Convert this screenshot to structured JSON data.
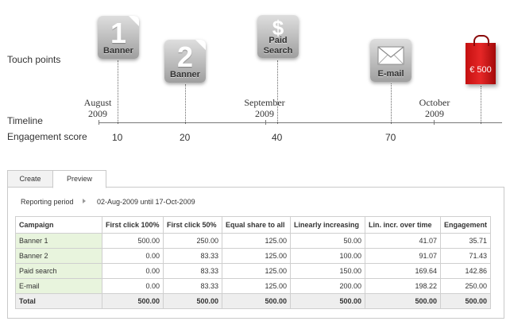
{
  "labels": {
    "touch_points": "Touch points",
    "timeline": "Timeline",
    "engagement_score": "Engagement score"
  },
  "touchpoints": [
    {
      "number": "1",
      "caption": "Banner",
      "icon": "document-1-icon"
    },
    {
      "number": "2",
      "caption": "Banner",
      "icon": "document-2-icon"
    },
    {
      "symbol": "$",
      "caption_line1": "Paid",
      "caption_line2": "Search",
      "icon": "paid-search-icon"
    },
    {
      "caption": "E-mail",
      "icon": "envelope-icon"
    }
  ],
  "conversion": {
    "price": "€ 500",
    "icon": "shopping-bag-icon",
    "color": "#d81c1c"
  },
  "months": [
    {
      "line1": "August",
      "line2": "2009"
    },
    {
      "line1": "September",
      "line2": "2009"
    },
    {
      "line1": "October",
      "line2": "2009"
    }
  ],
  "scores": [
    "10",
    "20",
    "40",
    "70"
  ],
  "tabs": [
    {
      "label": "Create",
      "active": false
    },
    {
      "label": "Preview",
      "active": true
    }
  ],
  "reporting_period": {
    "label": "Reporting period",
    "value": "02-Aug-2009 until 17-Oct-2009"
  },
  "table": {
    "columns": [
      "Campaign",
      "First click 100%",
      "First click 50%",
      "Equal share to all",
      "Linearly increasing",
      "Lin. incr. over time",
      "Engagement"
    ],
    "rows": [
      [
        "Banner 1",
        "500.00",
        "250.00",
        "125.00",
        "50.00",
        "41.07",
        "35.71"
      ],
      [
        "Banner 2",
        "0.00",
        "83.33",
        "125.00",
        "100.00",
        "91.07",
        "71.43"
      ],
      [
        "Paid search",
        "0.00",
        "83.33",
        "125.00",
        "150.00",
        "169.64",
        "142.86"
      ],
      [
        "E-mail",
        "0.00",
        "83.33",
        "125.00",
        "200.00",
        "198.22",
        "250.00"
      ]
    ],
    "total": [
      "Total",
      "500.00",
      "500.00",
      "500.00",
      "500.00",
      "500.00",
      "500.00"
    ]
  }
}
